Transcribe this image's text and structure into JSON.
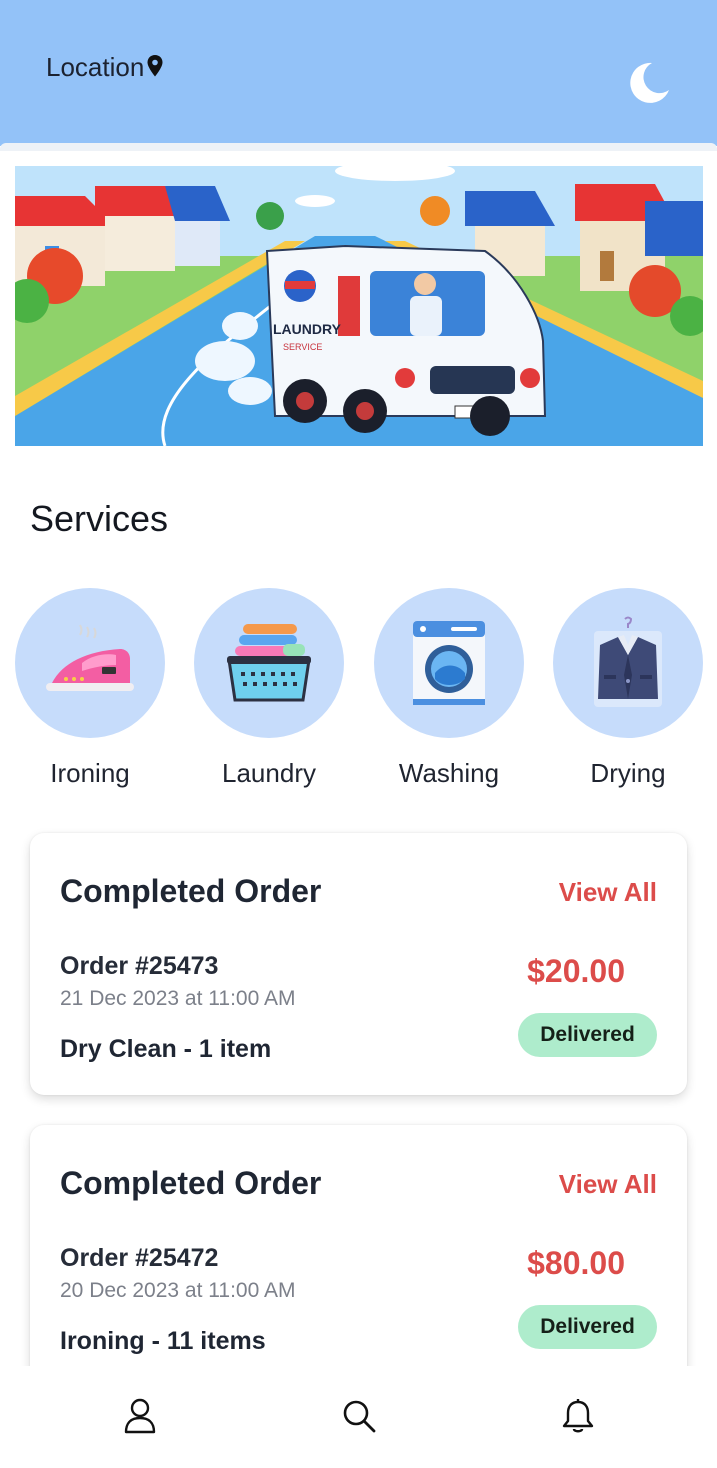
{
  "header": {
    "location_label": "Location",
    "icons": [
      "location-pin-icon",
      "moon-icon"
    ],
    "background": "#93c2f8"
  },
  "banner": {
    "van_logo_text": "LAUNDRY",
    "van_logo_subtext": "SERVICE"
  },
  "services": {
    "title": "Services",
    "items": [
      {
        "label": "Ironing",
        "icon": "iron-icon"
      },
      {
        "label": "Laundry",
        "icon": "laundry-basket-icon"
      },
      {
        "label": "Washing",
        "icon": "washing-machine-icon"
      },
      {
        "label": "Drying",
        "icon": "suit-icon"
      }
    ]
  },
  "orders": [
    {
      "title": "Completed Order",
      "view_all": "View All",
      "order_number": "Order #25473",
      "date": "21 Dec 2023 at 11:00 AM",
      "item": "Dry Clean - 1 item",
      "price": "$20.00",
      "status": "Delivered"
    },
    {
      "title": "Completed Order",
      "view_all": "View All",
      "order_number": "Order #25472",
      "date": "20 Dec 2023 at 11:00 AM",
      "item": "Ironing - 11 items",
      "price": "$80.00",
      "status": "Delivered"
    }
  ],
  "bottom_nav": {
    "icons": [
      "profile-icon",
      "search-icon",
      "bell-icon"
    ]
  },
  "colors": {
    "accent_red": "#dc4c4a",
    "badge_green": "#aeeccc",
    "service_circle": "#c6dcfb"
  }
}
